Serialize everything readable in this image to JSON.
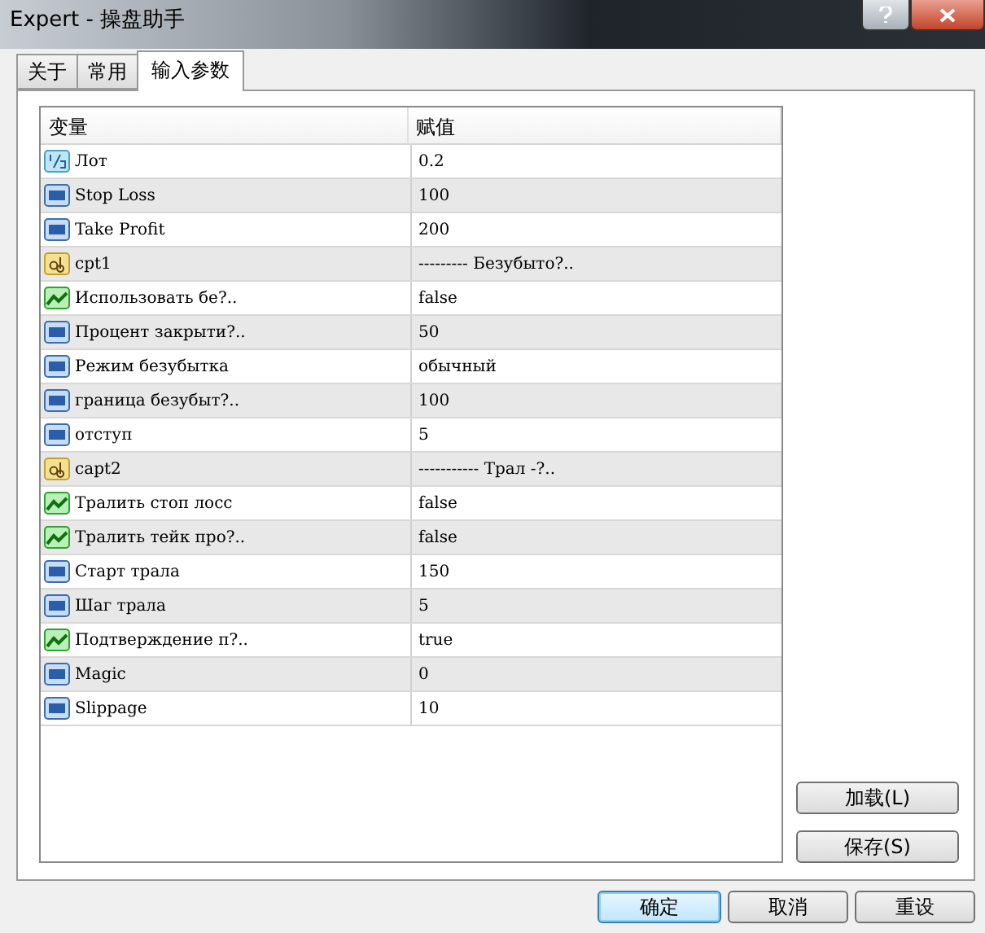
{
  "window": {
    "title": "Expert - 操盘助手"
  },
  "tabs": [
    {
      "label": "关于",
      "selected": false
    },
    {
      "label": "常用",
      "selected": false
    },
    {
      "label": "输入参数",
      "selected": true
    }
  ],
  "table": {
    "columns": [
      "变量",
      "赋值"
    ],
    "rows": [
      {
        "kind": "double",
        "name": "Лот",
        "value": "0.2"
      },
      {
        "kind": "int",
        "name": "Stop Loss",
        "value": "100"
      },
      {
        "kind": "int",
        "name": "Take Profit",
        "value": "200"
      },
      {
        "kind": "string",
        "name": "cpt1",
        "value": "--------- Безубыто?.."
      },
      {
        "kind": "bool",
        "name": "Использовать бе?..",
        "value": "false"
      },
      {
        "kind": "int",
        "name": "Процент закрыти?..",
        "value": "50"
      },
      {
        "kind": "int",
        "name": "Режим безубытка",
        "value": "обычный"
      },
      {
        "kind": "int",
        "name": "граница безубыт?..",
        "value": "100"
      },
      {
        "kind": "int",
        "name": "отступ",
        "value": "5"
      },
      {
        "kind": "string",
        "name": "capt2",
        "value": "----------- Трал -?.."
      },
      {
        "kind": "bool",
        "name": "Тралить стоп лосс",
        "value": "false"
      },
      {
        "kind": "bool",
        "name": "Тралить тейк про?..",
        "value": "false"
      },
      {
        "kind": "int",
        "name": "Старт трала",
        "value": "150"
      },
      {
        "kind": "int",
        "name": "Шаг трала",
        "value": "5"
      },
      {
        "kind": "bool",
        "name": "Подтверждение п?..",
        "value": "true"
      },
      {
        "kind": "int",
        "name": "Magic",
        "value": "0"
      },
      {
        "kind": "int",
        "name": "Slippage",
        "value": "10"
      }
    ]
  },
  "side_buttons": [
    "加载(L)",
    "保存(S)"
  ],
  "buttons": [
    {
      "label": "确定",
      "selected": true
    },
    {
      "label": "取消",
      "selected": false
    },
    {
      "label": "重设",
      "selected": false
    }
  ]
}
